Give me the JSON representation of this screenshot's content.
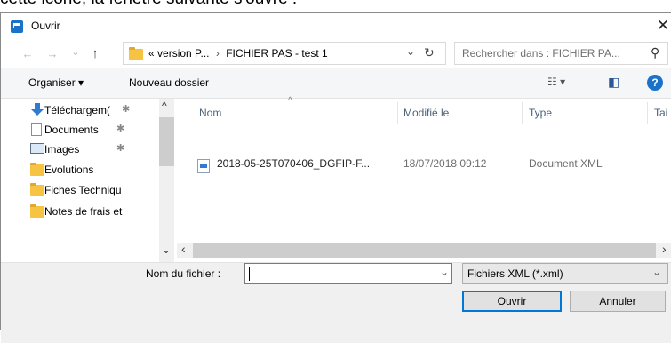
{
  "background_caption": "cette icône, la fenêtre suivante s'ouvre :",
  "dialog": {
    "title": "Ouvrir",
    "close_glyph": "✕",
    "icon": "open-dialog-icon"
  },
  "nav": {
    "back_glyph": "←",
    "forward_glyph": "→",
    "recent_glyph": "⌄",
    "up_glyph": "↑",
    "path_prefix": "«",
    "path_1": "version P...",
    "separator": "›",
    "path_2": "FICHIER PAS - test 1",
    "dropdown_glyph": "⌄",
    "refresh_glyph": "↻",
    "search_placeholder": "Rechercher dans : FICHIER PA...",
    "search_glyph": "⚲"
  },
  "toolbar": {
    "organize": "Organiser ▾",
    "new_folder": "Nouveau dossier",
    "view_glyph": "☷ ▾",
    "preview_glyph": "◧",
    "help_glyph": "?"
  },
  "sidebar": {
    "items": [
      {
        "label": "Téléchargem(",
        "icon": "download-icon",
        "pinned": "✱"
      },
      {
        "label": "Documents",
        "icon": "documents-icon",
        "pinned": "✱"
      },
      {
        "label": "Images",
        "icon": "images-icon",
        "pinned": "✱"
      },
      {
        "label": "Evolutions",
        "icon": "folder-icon",
        "pinned": ""
      },
      {
        "label": "Fiches Techniqu",
        "icon": "folder-icon",
        "pinned": ""
      },
      {
        "label": "Notes de frais et",
        "icon": "folder-icon",
        "pinned": ""
      }
    ],
    "scroll_up": "^",
    "scroll_down": "⌄"
  },
  "table": {
    "columns": [
      "Nom",
      "Modifié le",
      "Type",
      "Tai"
    ],
    "sort_glyph": "^",
    "rows": [
      {
        "name": "2018-05-25T070406_DGFIP-F...",
        "modified": "18/07/2018 09:12",
        "type": "Document XML"
      }
    ],
    "hscroll_left": "‹",
    "hscroll_right": "›"
  },
  "footer": {
    "filename_label": "Nom du fichier :",
    "filename_value": "",
    "filename_dropdown": "⌄",
    "filetype_value": "Fichiers XML (*.xml)",
    "filetype_dropdown": "⌄",
    "open_button": "Ouvrir",
    "cancel_button": "Annuler"
  }
}
